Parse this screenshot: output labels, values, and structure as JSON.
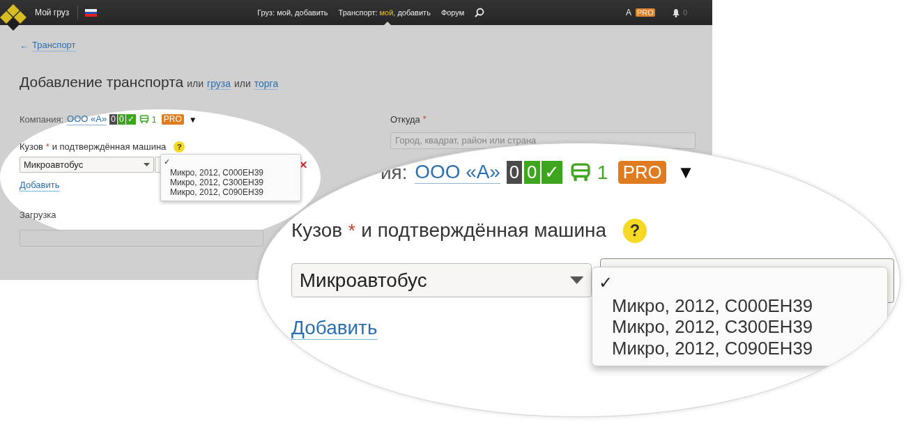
{
  "header": {
    "site_name": "Мой груз",
    "nav": [
      {
        "label": "Груз:",
        "links": [
          {
            "text": "мой,",
            "selected": false
          },
          {
            "text": "добавить",
            "selected": false
          }
        ]
      },
      {
        "label": "Транспорт:",
        "links": [
          {
            "text": "мой,",
            "selected": true
          },
          {
            "text": "добавить",
            "selected": false
          }
        ]
      }
    ],
    "forum_link": "Форум",
    "user": "А",
    "user_badge": "PRO",
    "notifications": "0"
  },
  "page": {
    "back_arrow": "←",
    "back_link": "Транспорт",
    "title": "Добавление транспорта",
    "title_alternatives": [
      {
        "connector": "или",
        "link": "груза"
      },
      {
        "connector": "или",
        "link": "торга"
      }
    ],
    "company": {
      "label": "Компания:",
      "name": "ООО «А»",
      "counters": [
        {
          "text": "0",
          "color": "#4a4a4a"
        },
        {
          "text": "0",
          "color": "#3da61e"
        },
        {
          "text": "✓",
          "color": "#3da61e"
        }
      ],
      "vehicles": "1",
      "badge": "PRO",
      "menu": "▼"
    },
    "body_field": {
      "label": "Кузов",
      "required_mark": "*",
      "label_rest": "и подтверждённая машина",
      "help": "?",
      "value": "Микроавтобус"
    },
    "vehicle_dropdown": {
      "check": "✓",
      "options": [
        {
          "label": "Микро, 2012, С000ЕН39",
          "selected": false
        },
        {
          "label": "Микро, 2012, С300ЕН39",
          "selected": false
        },
        {
          "label": "Микро, 2012, С090ЕН39",
          "selected": false
        }
      ]
    },
    "add_link": "Добавить",
    "load_field": {
      "label": "Загрузка"
    },
    "from_field": {
      "label": "Откуда",
      "required_mark": "*",
      "placeholder": "Город, квадрат, район или страна"
    }
  },
  "callout": {
    "company": {
      "label": "ия:",
      "name": "ООО «А»",
      "counters": [
        {
          "text": "0",
          "color": "#4a4a4a"
        },
        {
          "text": "0",
          "color": "#3da61e"
        },
        {
          "text": "✓",
          "color": "#3da61e"
        }
      ],
      "vehicles": "1",
      "badge": "PRO",
      "menu": "▼"
    },
    "body_field": {
      "label": "Кузов",
      "required_mark": "*",
      "label_rest": "и подтверждённая машина",
      "help": "?",
      "value": "Микроавтобус"
    },
    "vehicle_dropdown": {
      "check": "✓",
      "options": [
        {
          "label": "Микро, 2012, С000ЕН39",
          "selected": false
        },
        {
          "label": "Микро, 2012, С300ЕН39",
          "selected": false
        },
        {
          "label": "Микро, 2012, С090ЕН39",
          "selected": false
        }
      ]
    },
    "add_link": "Добавить"
  }
}
